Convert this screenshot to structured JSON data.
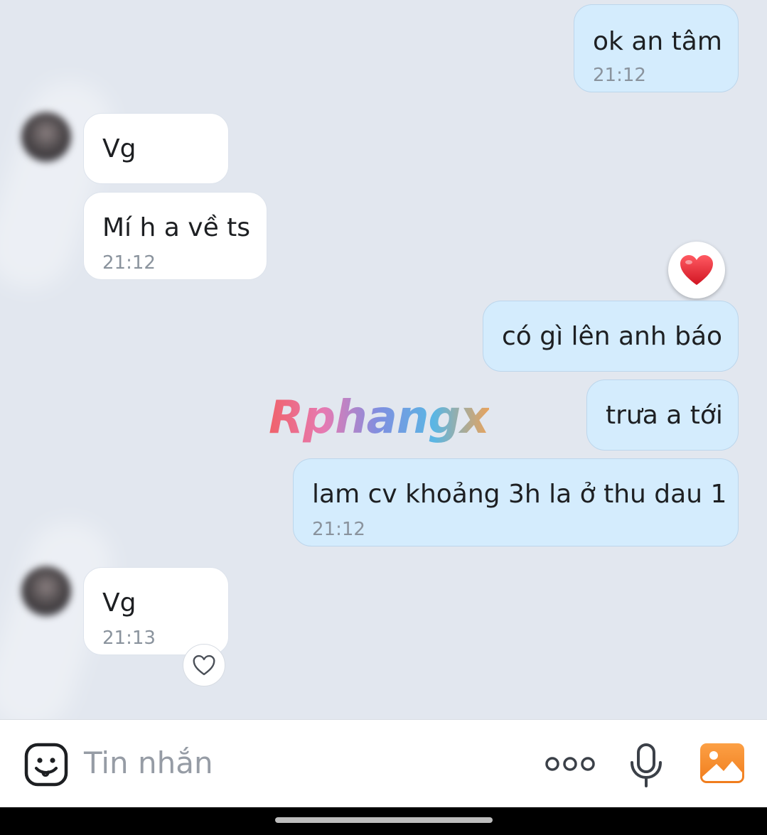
{
  "messages": [
    {
      "side": "out",
      "text": "ok an tâm",
      "time": "21:12"
    },
    {
      "side": "in",
      "text": "Vg"
    },
    {
      "side": "in",
      "text": "Mí h a về ts",
      "time": "21:12"
    },
    {
      "side": "out",
      "text": "có gì lên anh báo",
      "reaction": "heart-filled"
    },
    {
      "side": "out",
      "text": "trưa a tới"
    },
    {
      "side": "out",
      "text": "lam cv khoảng 3h la ở thu dau 1",
      "time": "21:12"
    },
    {
      "side": "in",
      "text": "Vg",
      "time": "21:13",
      "reaction": "heart-outline"
    }
  ],
  "watermark": "Rphangx",
  "composer": {
    "placeholder": "Tin nhắn",
    "icons": [
      "sticker-icon",
      "more-icon",
      "microphone-icon",
      "image-icon"
    ]
  },
  "colors": {
    "chat_background": "#e2e7ef",
    "outgoing_bubble": "#d4ecfd",
    "incoming_bubble": "#ffffff",
    "heart": "#e8232f",
    "image_button": "#f7922e"
  }
}
